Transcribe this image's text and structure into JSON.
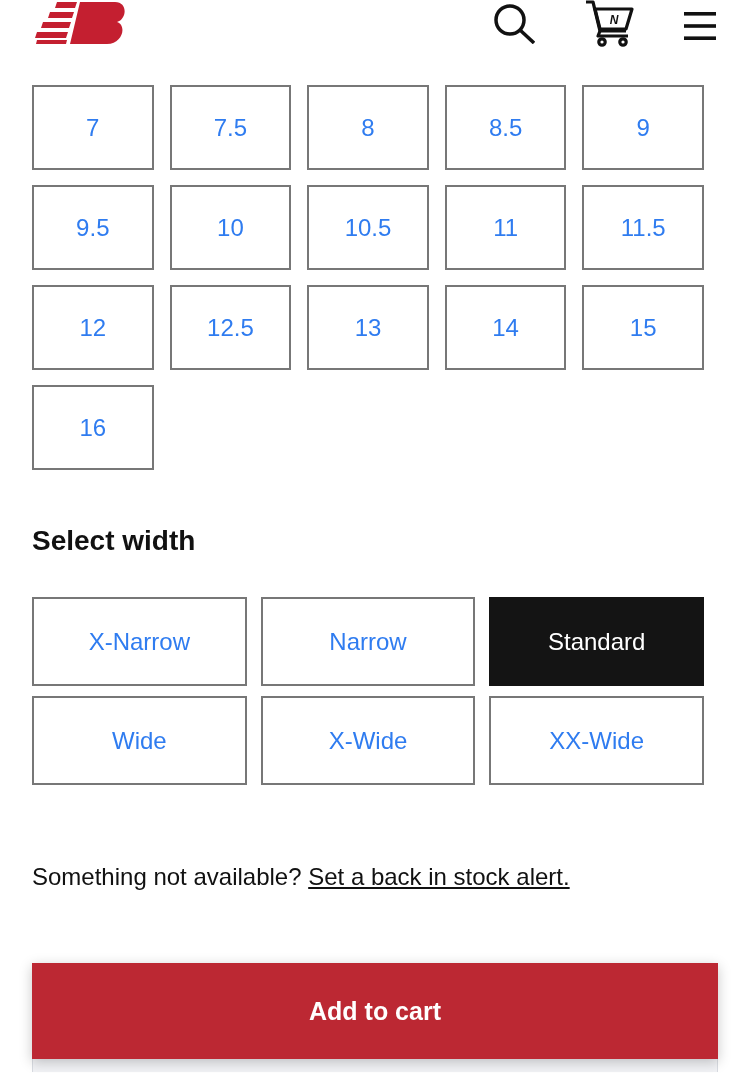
{
  "header": {
    "cart_label": "N"
  },
  "sizes": [
    {
      "label": "7",
      "selected": false
    },
    {
      "label": "7.5",
      "selected": false
    },
    {
      "label": "8",
      "selected": false
    },
    {
      "label": "8.5",
      "selected": false
    },
    {
      "label": "9",
      "selected": false
    },
    {
      "label": "9.5",
      "selected": false
    },
    {
      "label": "10",
      "selected": false
    },
    {
      "label": "10.5",
      "selected": false
    },
    {
      "label": "11",
      "selected": false
    },
    {
      "label": "11.5",
      "selected": false
    },
    {
      "label": "12",
      "selected": false
    },
    {
      "label": "12.5",
      "selected": false
    },
    {
      "label": "13",
      "selected": false
    },
    {
      "label": "14",
      "selected": false
    },
    {
      "label": "15",
      "selected": false
    },
    {
      "label": "16",
      "selected": false
    }
  ],
  "width_section": {
    "title": "Select width",
    "widths": [
      {
        "label": "X-Narrow",
        "selected": false
      },
      {
        "label": "Narrow",
        "selected": false
      },
      {
        "label": "Standard",
        "selected": true
      },
      {
        "label": "Wide",
        "selected": false
      },
      {
        "label": "X-Wide",
        "selected": false
      },
      {
        "label": "XX-Wide",
        "selected": false
      }
    ]
  },
  "stock_note": {
    "text": "Something not available?",
    "link": "Set a back in stock alert."
  },
  "add_to_cart": {
    "label": "Add to cart"
  }
}
